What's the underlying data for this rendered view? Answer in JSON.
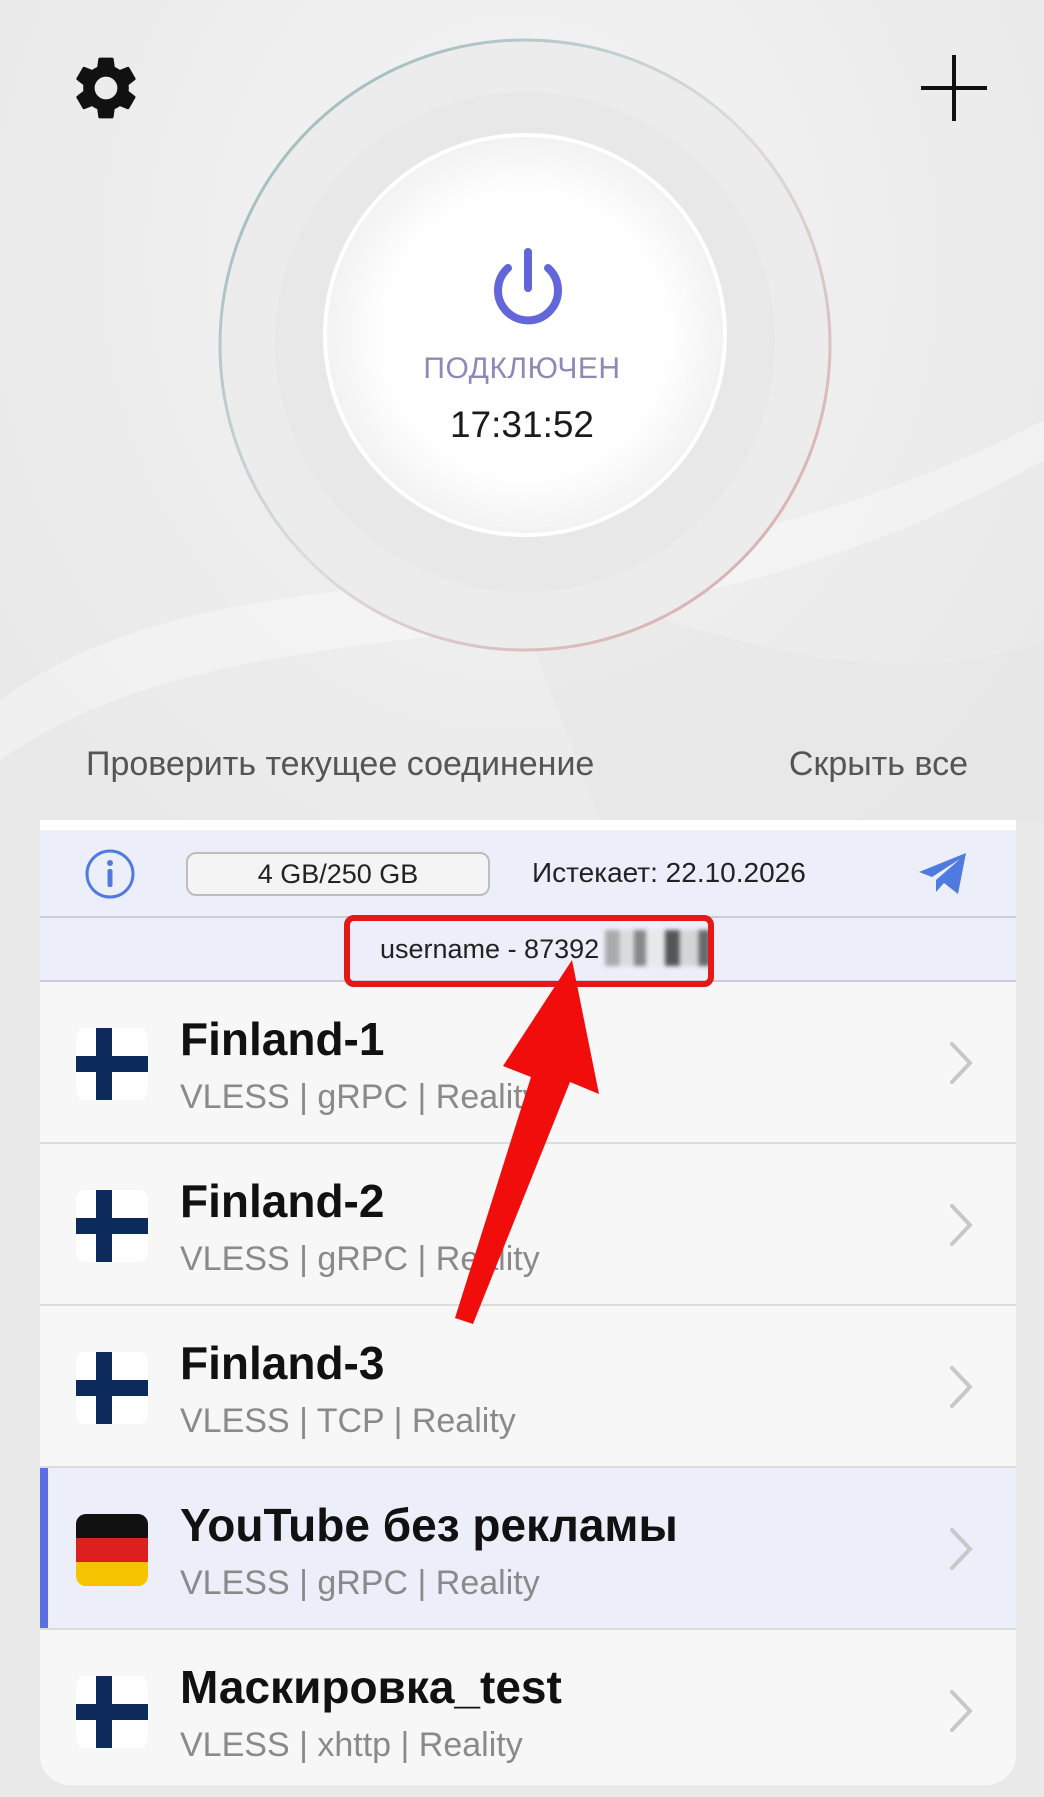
{
  "header": {
    "settings_icon": "gear-icon",
    "add_icon": "plus-icon"
  },
  "connection": {
    "status": "ПОДКЛЮЧЕН",
    "timer": "17:31:52",
    "power_icon": "power-icon",
    "accent_color": "#6366d9"
  },
  "links": {
    "check": "Проверить текущее соединение",
    "hide": "Скрыть все"
  },
  "subscription": {
    "info_icon": "info-icon",
    "traffic": "4 GB/250 GB",
    "expires": "Истекает: 22.10.2026",
    "telegram_icon": "telegram-icon",
    "username": "username - 87392"
  },
  "servers": [
    {
      "name": "Finland-1",
      "protocol": "VLESS | gRPC | Reality",
      "flag": "finland-flag",
      "active": false
    },
    {
      "name": "Finland-2",
      "protocol": "VLESS | gRPC | Reality",
      "flag": "finland-flag",
      "active": false
    },
    {
      "name": "Finland-3",
      "protocol": "VLESS | TCP | Reality",
      "flag": "finland-flag",
      "active": false
    },
    {
      "name": "YouTube без рекламы",
      "protocol": "VLESS | gRPC | Reality",
      "flag": "germany-flag",
      "active": true
    },
    {
      "name": "Маскировка_test",
      "protocol": "VLESS | xhttp | Reality",
      "flag": "finland-flag",
      "active": false
    }
  ],
  "annotation": {
    "highlight_color": "#e41818"
  }
}
